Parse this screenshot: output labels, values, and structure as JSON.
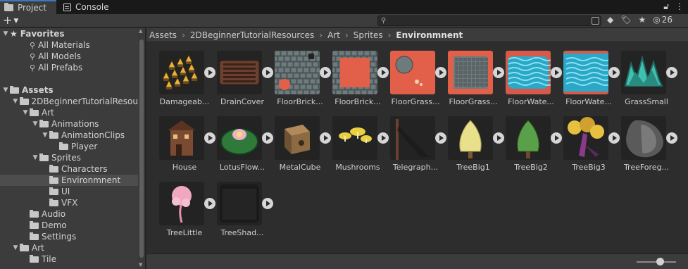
{
  "tabs": [
    {
      "label": "Project",
      "icon": "folder-icon",
      "active": true
    },
    {
      "label": "Console",
      "icon": "console-icon",
      "active": false
    }
  ],
  "toolbar": {
    "add_symbol": "+",
    "hidden_count": "26"
  },
  "sidebar": {
    "rows": [
      {
        "label": "Favorites",
        "depth": 0,
        "arrow": "▼",
        "icon": "star",
        "bold": true
      },
      {
        "label": "All Materials",
        "depth": 2,
        "arrow": "",
        "icon": "search"
      },
      {
        "label": "All Models",
        "depth": 2,
        "arrow": "",
        "icon": "search"
      },
      {
        "label": "All Prefabs",
        "depth": 2,
        "arrow": "",
        "icon": "search"
      },
      {
        "label": "",
        "depth": 0,
        "arrow": "",
        "icon": "none"
      },
      {
        "label": "Assets",
        "depth": 0,
        "arrow": "▼",
        "icon": "folder",
        "bold": true
      },
      {
        "label": "2DBeginnerTutorialResou",
        "depth": 1,
        "arrow": "▼",
        "icon": "folder"
      },
      {
        "label": "Art",
        "depth": 2,
        "arrow": "▼",
        "icon": "folder"
      },
      {
        "label": "Animations",
        "depth": 3,
        "arrow": "▼",
        "icon": "folder"
      },
      {
        "label": "AnimationClips",
        "depth": 4,
        "arrow": "▼",
        "icon": "folder"
      },
      {
        "label": "Player",
        "depth": 5,
        "arrow": "",
        "icon": "folder"
      },
      {
        "label": "Sprites",
        "depth": 3,
        "arrow": "▼",
        "icon": "folder"
      },
      {
        "label": "Characters",
        "depth": 4,
        "arrow": "",
        "icon": "folder"
      },
      {
        "label": "Environmnent",
        "depth": 4,
        "arrow": "",
        "icon": "folder",
        "selected": true
      },
      {
        "label": "UI",
        "depth": 4,
        "arrow": "",
        "icon": "folder"
      },
      {
        "label": "VFX",
        "depth": 4,
        "arrow": "",
        "icon": "folder"
      },
      {
        "label": "Audio",
        "depth": 2,
        "arrow": "",
        "icon": "folder"
      },
      {
        "label": "Demo",
        "depth": 2,
        "arrow": "",
        "icon": "folder"
      },
      {
        "label": "Settings",
        "depth": 2,
        "arrow": "",
        "icon": "folder"
      },
      {
        "label": "Art",
        "depth": 1,
        "arrow": "▼",
        "icon": "folder"
      },
      {
        "label": "Tile",
        "depth": 2,
        "arrow": "",
        "icon": "folder"
      }
    ]
  },
  "breadcrumb": [
    "Assets",
    "2DBeginnerTutorialResources",
    "Art",
    "Sprites",
    "Environmnent"
  ],
  "assets": [
    {
      "label": "Damageab...",
      "kind": "spikes"
    },
    {
      "label": "DrainCover",
      "kind": "drain"
    },
    {
      "label": "FloorBrick...",
      "kind": "brick1"
    },
    {
      "label": "FloorBrick...",
      "kind": "brick2"
    },
    {
      "label": "FloorGrass...",
      "kind": "grass1"
    },
    {
      "label": "FloorGrass...",
      "kind": "grass2"
    },
    {
      "label": "FloorWate...",
      "kind": "water1"
    },
    {
      "label": "FloorWate...",
      "kind": "water2"
    },
    {
      "label": "GrassSmall",
      "kind": "grasssmall"
    },
    {
      "label": "House",
      "kind": "house"
    },
    {
      "label": "LotusFlow...",
      "kind": "lotus"
    },
    {
      "label": "MetalCube",
      "kind": "cube"
    },
    {
      "label": "Mushrooms",
      "kind": "mushrooms"
    },
    {
      "label": "Telegraph...",
      "kind": "pole"
    },
    {
      "label": "TreeBig1",
      "kind": "tree1"
    },
    {
      "label": "TreeBig2",
      "kind": "tree2"
    },
    {
      "label": "TreeBig3",
      "kind": "tree3"
    },
    {
      "label": "TreeForeg...",
      "kind": "treefg"
    },
    {
      "label": "TreeLittle",
      "kind": "treelittle"
    },
    {
      "label": "TreeShad...",
      "kind": "treeshadow"
    }
  ]
}
